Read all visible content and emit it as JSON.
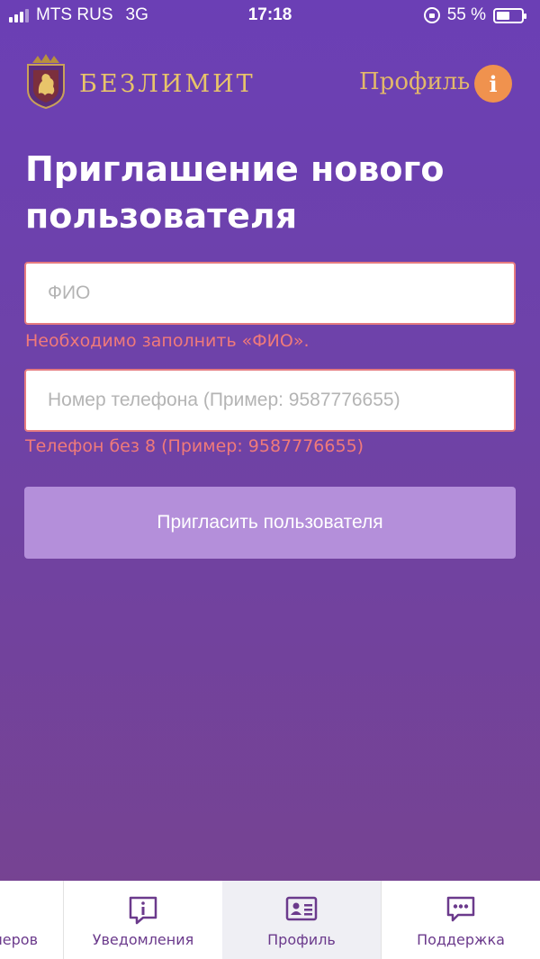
{
  "status_bar": {
    "carrier": "MTS RUS",
    "network": "3G",
    "time": "17:18",
    "battery": "55 %"
  },
  "header": {
    "brand": "БЕЗЛИМИТ",
    "profile_link": "Профиль",
    "info_icon_glyph": "i"
  },
  "page": {
    "title": "Приглашение нового пользователя"
  },
  "form": {
    "fio": {
      "placeholder": "ФИО",
      "value": "",
      "error": "Необходимо заполнить «ФИО»."
    },
    "phone": {
      "placeholder": "Номер телефона (Пример: 9587776655)",
      "value": "",
      "hint": "Телефон без 8 (Пример: 9587776655)"
    },
    "submit_label": "Пригласить пользователя"
  },
  "tab_bar": {
    "items": [
      {
        "label": "меров",
        "icon": "partial-icon"
      },
      {
        "label": "Уведомления",
        "icon": "notification-icon"
      },
      {
        "label": "Профиль",
        "icon": "profile-card-icon"
      },
      {
        "label": "Поддержка",
        "icon": "chat-icon"
      }
    ],
    "active_index": 2
  },
  "colors": {
    "background_top": "#6b3fb5",
    "background_bottom": "#77438f",
    "accent_gold": "#e8c46a",
    "info_orange": "#f0924e",
    "error": "#f07a7a",
    "button": "#b48fda",
    "tab_text": "#6b3a8c"
  }
}
